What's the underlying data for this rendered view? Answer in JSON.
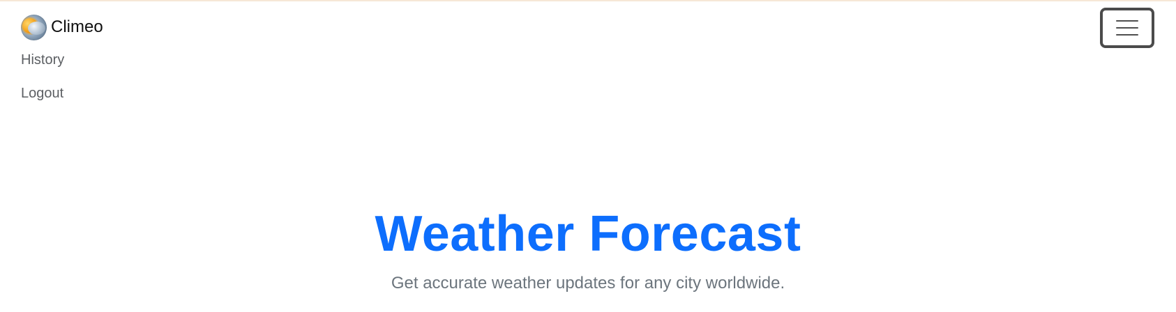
{
  "header": {
    "brand_name": "Climeo",
    "brand_logo_icon": "weather-sun-cloud-icon",
    "nav_links": [
      {
        "label": "History"
      },
      {
        "label": "Logout"
      }
    ],
    "menu_icon": "hamburger-menu-icon"
  },
  "hero": {
    "title": "Weather Forecast",
    "subtitle": "Get accurate weather updates for any city worldwide."
  },
  "colors": {
    "accent": "#0d6efd",
    "nav_text": "#5c5f63",
    "subtitle_text": "#6c757d",
    "top_border": "#f6e7d6"
  }
}
